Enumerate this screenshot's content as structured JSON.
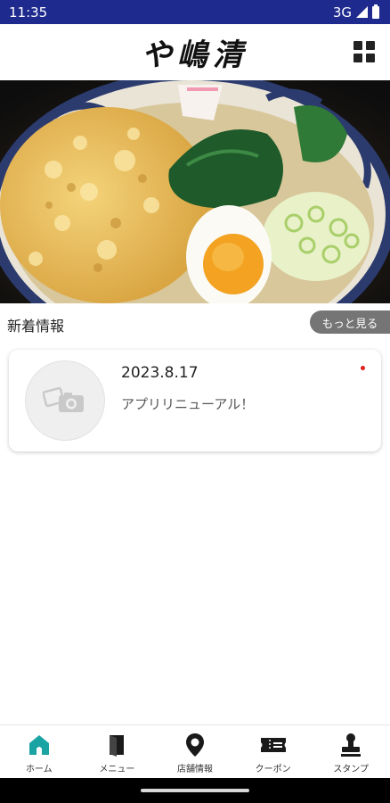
{
  "status_bar": {
    "time": "11:35",
    "network": "3G"
  },
  "header": {
    "logo_text": "や嶋清",
    "menu_icon": "grid-icon"
  },
  "hero": {
    "icon": "noodle-bowl-photo"
  },
  "news": {
    "title": "新着情報",
    "more_label": "もっと見る",
    "items": [
      {
        "date": "2023.8.17",
        "text": "アプリリニューアル！",
        "unread": true,
        "thumb_icon": "photo-placeholder-icon"
      }
    ]
  },
  "bottom_nav": {
    "active_color": "#1aa3a3",
    "items": [
      {
        "label": "ホーム",
        "icon": "home-icon",
        "active": true
      },
      {
        "label": "メニュー",
        "icon": "book-icon",
        "active": false
      },
      {
        "label": "店舗情報",
        "icon": "map-pin-icon",
        "active": false
      },
      {
        "label": "クーポン",
        "icon": "ticket-icon",
        "active": false
      },
      {
        "label": "スタンプ",
        "icon": "stamp-icon",
        "active": false
      }
    ]
  },
  "colors": {
    "status_bar": "#1e2a8e",
    "more_button": "#757575",
    "unread_dot": "#e02020"
  }
}
